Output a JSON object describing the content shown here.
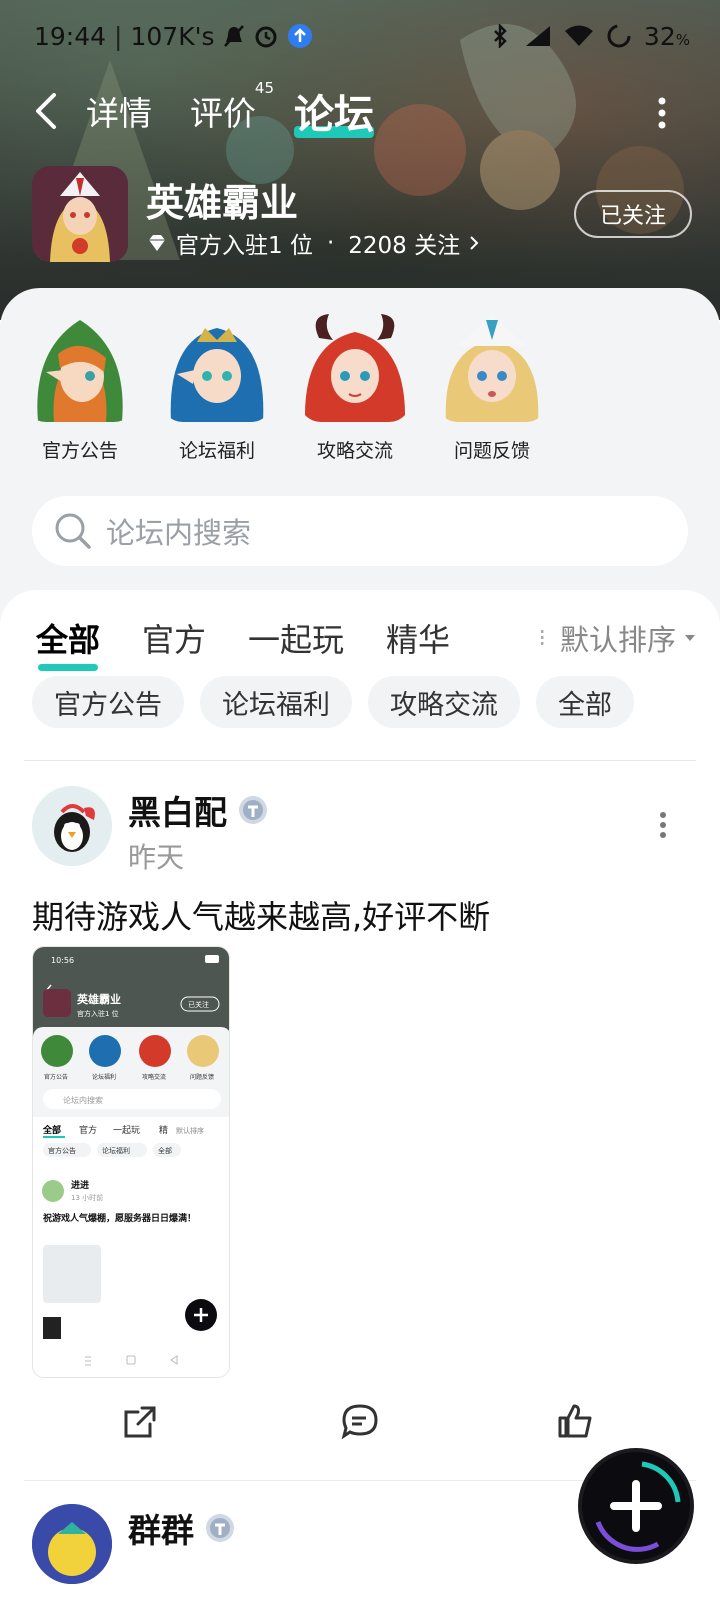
{
  "status_bar": {
    "time": "19:44",
    "speed": "107K's",
    "battery": "32"
  },
  "nav": {
    "back_icon": "chevron-left-icon",
    "tabs": [
      {
        "label": "详情"
      },
      {
        "label": "评价",
        "badge": "45"
      },
      {
        "label": "论坛"
      }
    ],
    "more_icon": "more-vertical-icon"
  },
  "game": {
    "title": "英雄霸业",
    "official_text": "官方入驻1 位",
    "dot": "·",
    "followers_text": "2208 关注",
    "follow_button": "已关注"
  },
  "sub_forums": [
    {
      "label": "官方公告"
    },
    {
      "label": "论坛福利"
    },
    {
      "label": "攻略交流"
    },
    {
      "label": "问题反馈"
    }
  ],
  "search": {
    "placeholder": "论坛内搜索"
  },
  "content_tabs": [
    {
      "label": "全部"
    },
    {
      "label": "官方"
    },
    {
      "label": "一起玩"
    },
    {
      "label": "精华"
    }
  ],
  "sort": {
    "label": "默认排序"
  },
  "chips": [
    {
      "label": "官方公告"
    },
    {
      "label": "论坛福利"
    },
    {
      "label": "攻略交流"
    },
    {
      "label": "全部"
    }
  ],
  "post1": {
    "username": "黑白配",
    "time": "昨天",
    "text": "期待游戏人气越来越高,好评不断",
    "screenshot": {
      "time": "10:56",
      "game_title": "英雄霸业",
      "official": "官方入驻1 位",
      "follow": "已关注",
      "sub": [
        "官方公告",
        "论坛福利",
        "攻略交流",
        "问题反馈"
      ],
      "search": "论坛内搜索",
      "tabs": [
        "全部",
        "官方",
        "一起玩",
        "精"
      ],
      "sort": "默认排序",
      "chips": [
        "官方公告",
        "论坛福利",
        "全部"
      ],
      "post_user": "进进",
      "post_time": "13 小时前",
      "post_text": "祝游戏人气爆棚，愿服务器日日爆满！"
    }
  },
  "post2": {
    "username": "群群"
  },
  "fab_icon": "plus-icon",
  "colors": {
    "accent": "#1ec9b8"
  }
}
